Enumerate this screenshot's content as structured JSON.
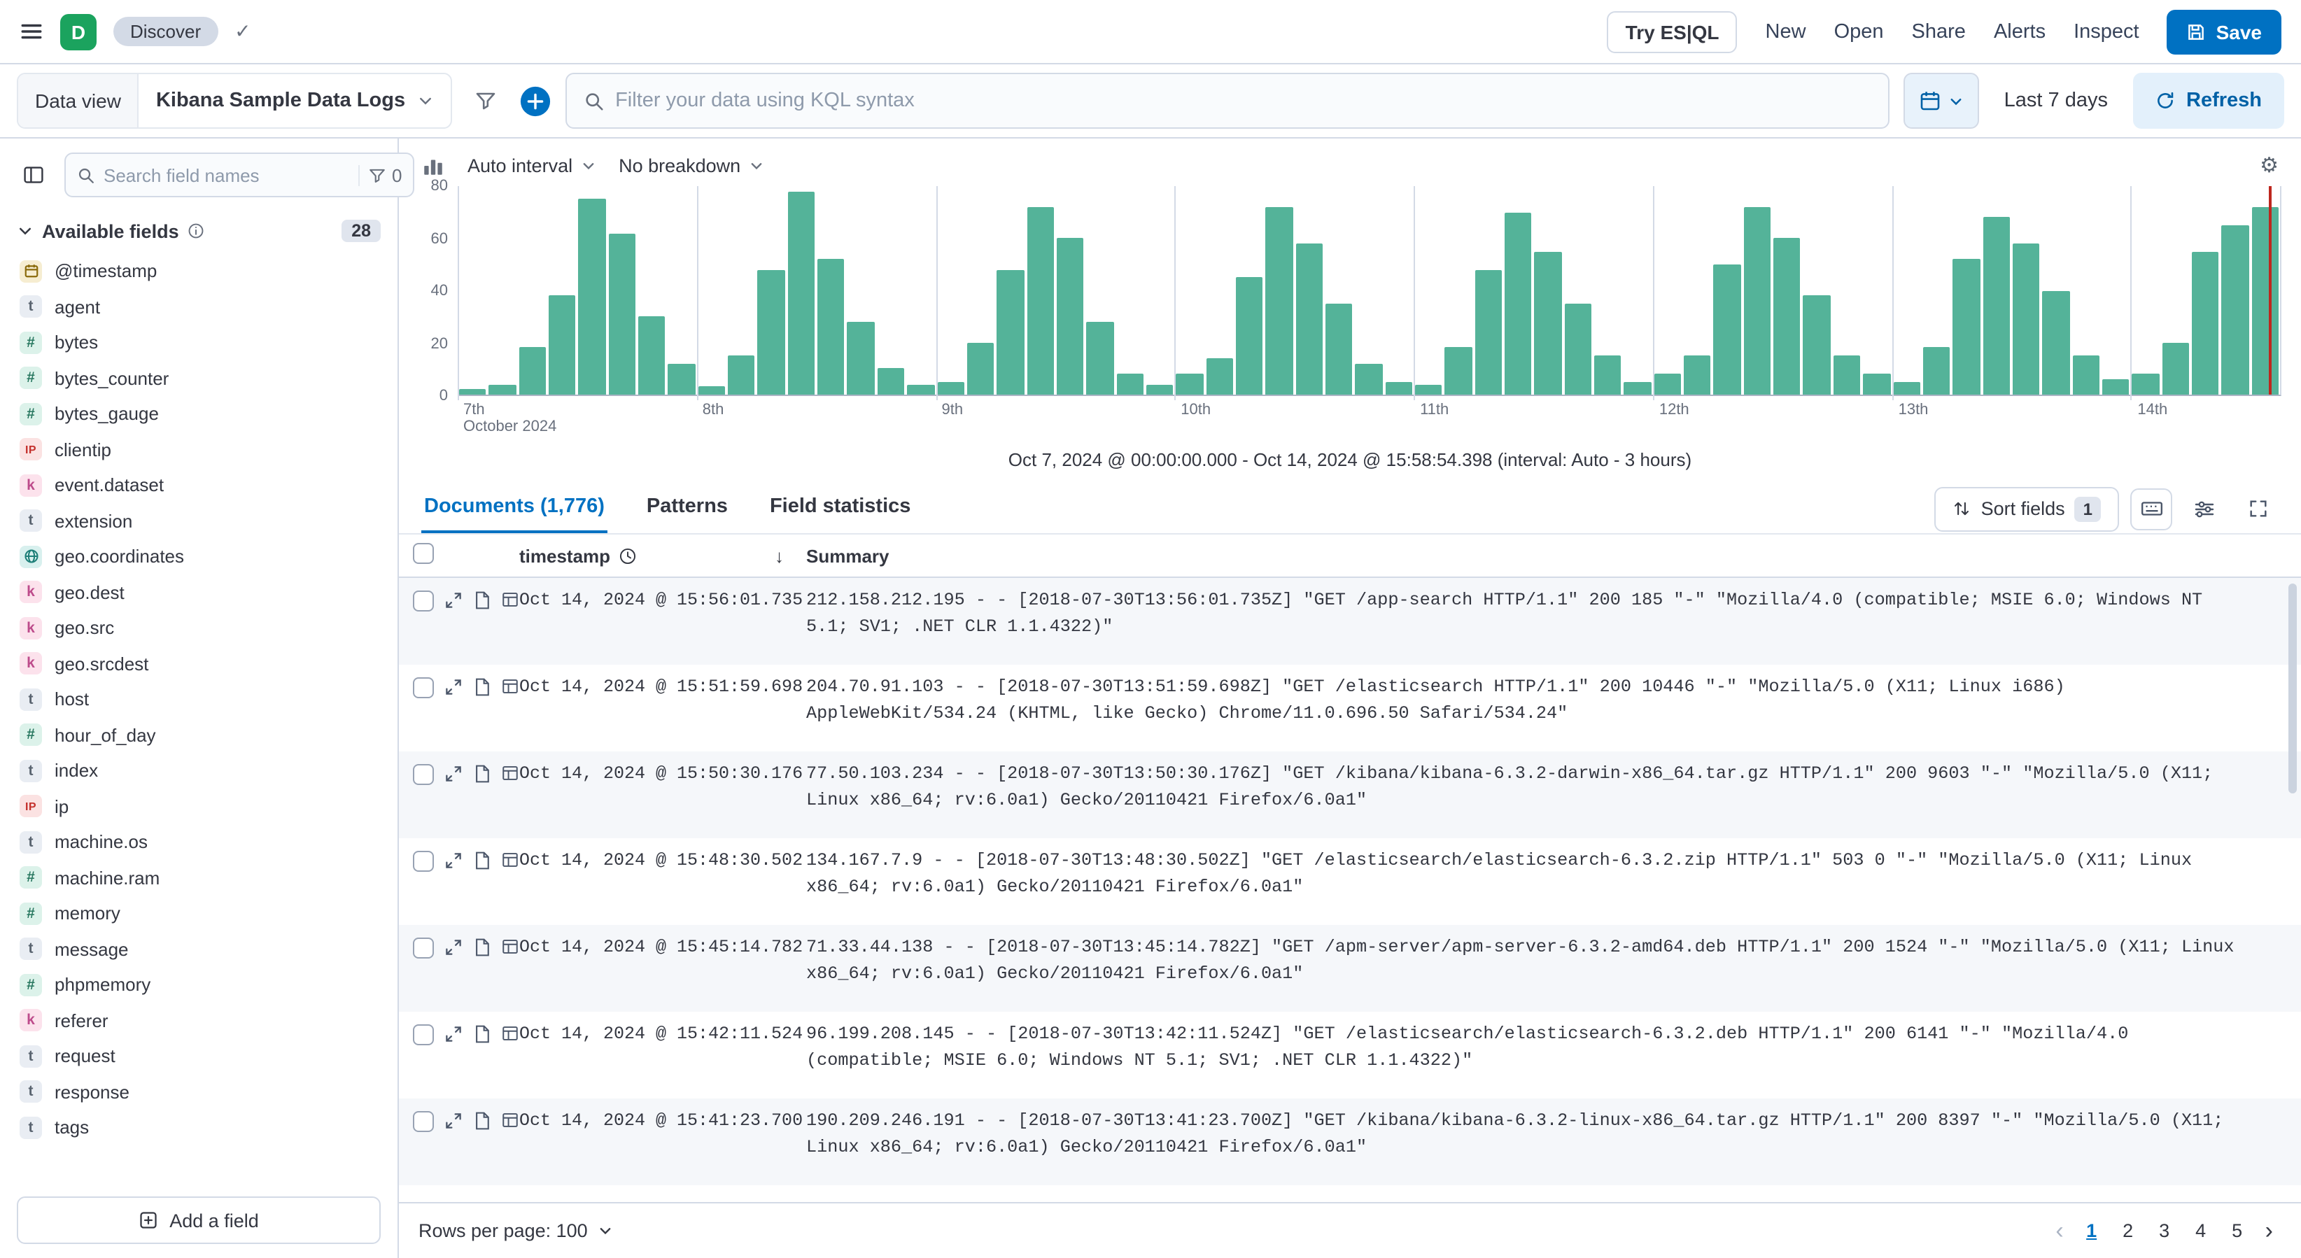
{
  "colors": {
    "primary": "#0071C2",
    "bar": "#54B399",
    "time_marker": "#BD271E",
    "logo": "#1BA35E",
    "border": "#D3DAE6"
  },
  "header": {
    "logo_letter": "D",
    "breadcrumb": "Discover",
    "try_esql_label": "Try ES|QL",
    "nav_links": [
      "New",
      "Open",
      "Share",
      "Alerts",
      "Inspect"
    ],
    "save_label": "Save"
  },
  "toolbar": {
    "data_view_label": "Data view",
    "data_view_value": "Kibana Sample Data Logs",
    "search_placeholder": "Filter your data using KQL syntax",
    "time_range": "Last 7 days",
    "refresh_label": "Refresh"
  },
  "sidebar": {
    "search_placeholder": "Search field names",
    "filter_count": "0",
    "section_title": "Available fields",
    "section_count": "28",
    "add_field_label": "Add a field",
    "fields": [
      {
        "name": "@timestamp",
        "type": "date"
      },
      {
        "name": "agent",
        "type": "text"
      },
      {
        "name": "bytes",
        "type": "number"
      },
      {
        "name": "bytes_counter",
        "type": "number"
      },
      {
        "name": "bytes_gauge",
        "type": "number"
      },
      {
        "name": "clientip",
        "type": "ip"
      },
      {
        "name": "event.dataset",
        "type": "keyword"
      },
      {
        "name": "extension",
        "type": "text"
      },
      {
        "name": "geo.coordinates",
        "type": "geo"
      },
      {
        "name": "geo.dest",
        "type": "keyword"
      },
      {
        "name": "geo.src",
        "type": "keyword"
      },
      {
        "name": "geo.srcdest",
        "type": "keyword"
      },
      {
        "name": "host",
        "type": "text"
      },
      {
        "name": "hour_of_day",
        "type": "number"
      },
      {
        "name": "index",
        "type": "text"
      },
      {
        "name": "ip",
        "type": "ip"
      },
      {
        "name": "machine.os",
        "type": "text"
      },
      {
        "name": "machine.ram",
        "type": "number"
      },
      {
        "name": "memory",
        "type": "number"
      },
      {
        "name": "message",
        "type": "text"
      },
      {
        "name": "phpmemory",
        "type": "number"
      },
      {
        "name": "referer",
        "type": "keyword"
      },
      {
        "name": "request",
        "type": "text"
      },
      {
        "name": "response",
        "type": "text"
      },
      {
        "name": "tags",
        "type": "text"
      }
    ]
  },
  "chart": {
    "interval_label": "Auto interval",
    "breakdown_label": "No breakdown",
    "caption": "Oct 7, 2024 @ 00:00:00.000 - Oct 14, 2024 @ 15:58:54.398 (interval: Auto - 3 hours)"
  },
  "chart_data": {
    "type": "bar",
    "title": "Document count histogram",
    "interval": "3 hours",
    "ylim": [
      0,
      80
    ],
    "yticks": [
      0,
      20,
      40,
      60,
      80
    ],
    "x_day_labels": [
      "7th",
      "8th",
      "9th",
      "10th",
      "11th",
      "12th",
      "13th",
      "14th"
    ],
    "x_sub_label": "October 2024",
    "bars_per_day": 8,
    "bar_color": "#54B399",
    "values": [
      2,
      4,
      18,
      38,
      75,
      62,
      30,
      12,
      3,
      15,
      48,
      78,
      52,
      28,
      10,
      4,
      5,
      20,
      48,
      72,
      60,
      28,
      8,
      4,
      8,
      14,
      45,
      72,
      58,
      35,
      12,
      5,
      4,
      18,
      48,
      70,
      55,
      35,
      15,
      5,
      8,
      15,
      50,
      72,
      60,
      38,
      15,
      8,
      5,
      18,
      52,
      68,
      58,
      40,
      15,
      6,
      8,
      20,
      55,
      65,
      72
    ],
    "legend": "off",
    "grid": "day-boundaries-vertical",
    "current_time_marker": true
  },
  "tabs": [
    {
      "label": "Documents (1,776)",
      "active": true
    },
    {
      "label": "Patterns",
      "active": false
    },
    {
      "label": "Field statistics",
      "active": false
    }
  ],
  "grid_controls": {
    "sort_fields_label": "Sort fields",
    "sort_fields_count": "1"
  },
  "table": {
    "timestamp_header": "timestamp",
    "summary_header": "Summary",
    "rows": [
      {
        "timestamp": "Oct 14, 2024 @ 15:56:01.735",
        "summary": "212.158.212.195 - - [2018-07-30T13:56:01.735Z] \"GET /app-search HTTP/1.1\" 200 185 \"-\" \"Mozilla/4.0 (compatible; MSIE 6.0; Windows NT 5.1; SV1; .NET CLR 1.1.4322)\""
      },
      {
        "timestamp": "Oct 14, 2024 @ 15:51:59.698",
        "summary": "204.70.91.103 - - [2018-07-30T13:51:59.698Z] \"GET /elasticsearch HTTP/1.1\" 200 10446 \"-\" \"Mozilla/5.0 (X11; Linux i686) AppleWebKit/534.24 (KHTML, like Gecko) Chrome/11.0.696.50 Safari/534.24\""
      },
      {
        "timestamp": "Oct 14, 2024 @ 15:50:30.176",
        "summary": "77.50.103.234 - - [2018-07-30T13:50:30.176Z] \"GET /kibana/kibana-6.3.2-darwin-x86_64.tar.gz HTTP/1.1\" 200 9603 \"-\" \"Mozilla/5.0 (X11; Linux x86_64; rv:6.0a1) Gecko/20110421 Firefox/6.0a1\""
      },
      {
        "timestamp": "Oct 14, 2024 @ 15:48:30.502",
        "summary": "134.167.7.9 - - [2018-07-30T13:48:30.502Z] \"GET /elasticsearch/elasticsearch-6.3.2.zip HTTP/1.1\" 503 0 \"-\" \"Mozilla/5.0 (X11; Linux x86_64; rv:6.0a1) Gecko/20110421 Firefox/6.0a1\""
      },
      {
        "timestamp": "Oct 14, 2024 @ 15:45:14.782",
        "summary": "71.33.44.138 - - [2018-07-30T13:45:14.782Z] \"GET /apm-server/apm-server-6.3.2-amd64.deb HTTP/1.1\" 200 1524 \"-\" \"Mozilla/5.0 (X11; Linux x86_64; rv:6.0a1) Gecko/20110421 Firefox/6.0a1\""
      },
      {
        "timestamp": "Oct 14, 2024 @ 15:42:11.524",
        "summary": "96.199.208.145 - - [2018-07-30T13:42:11.524Z] \"GET /elasticsearch/elasticsearch-6.3.2.deb HTTP/1.1\" 200 6141 \"-\" \"Mozilla/4.0 (compatible; MSIE 6.0; Windows NT 5.1; SV1; .NET CLR 1.1.4322)\""
      },
      {
        "timestamp": "Oct 14, 2024 @ 15:41:23.700",
        "summary": "190.209.246.191 - - [2018-07-30T13:41:23.700Z] \"GET /kibana/kibana-6.3.2-linux-x86_64.tar.gz HTTP/1.1\" 200 8397 \"-\" \"Mozilla/5.0 (X11; Linux x86_64; rv:6.0a1) Gecko/20110421 Firefox/6.0a1\""
      }
    ]
  },
  "pagination": {
    "rows_per_page_label": "Rows per page: 100",
    "pages": [
      "1",
      "2",
      "3",
      "4",
      "5"
    ],
    "active_page": "1"
  }
}
